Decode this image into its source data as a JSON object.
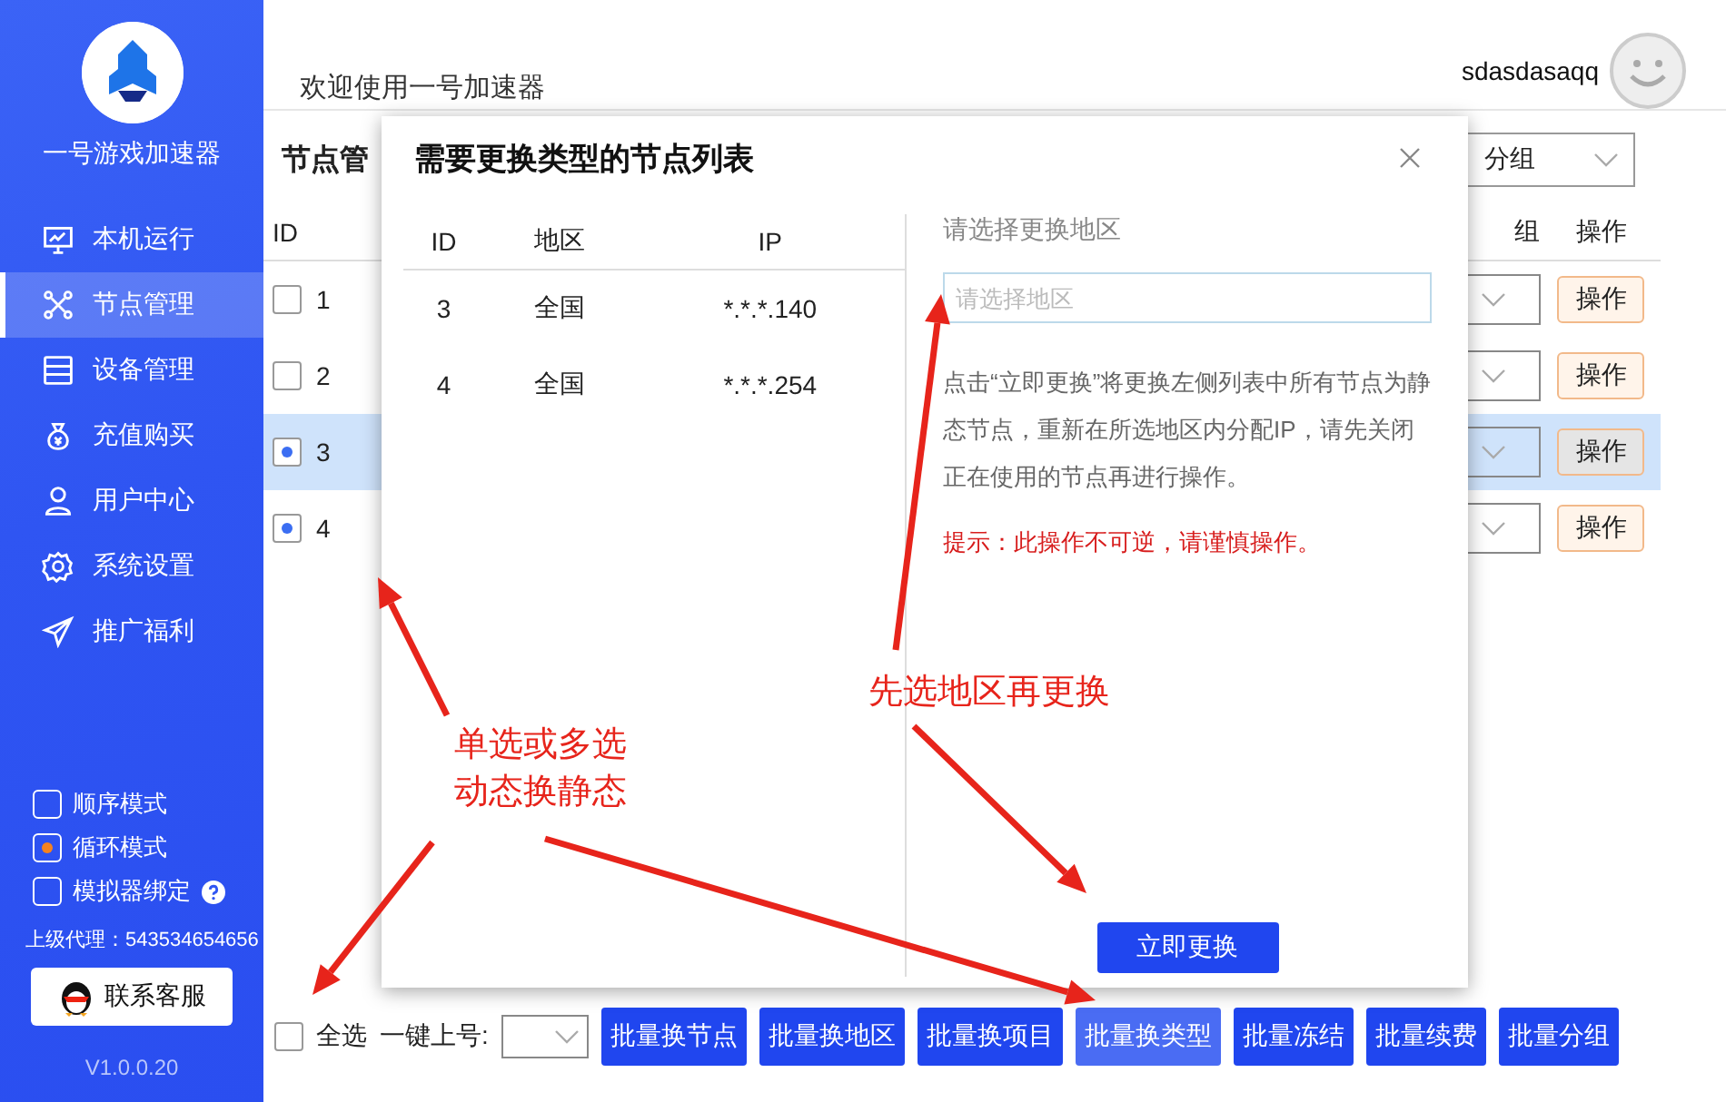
{
  "sidebar": {
    "app_name": "一号游戏加速器",
    "items": [
      {
        "label": "本机运行",
        "kind": "monitor",
        "selected": false
      },
      {
        "label": "节点管理",
        "kind": "nodes",
        "selected": true
      },
      {
        "label": "设备管理",
        "kind": "server",
        "selected": false
      },
      {
        "label": "充值购买",
        "kind": "moneybag",
        "selected": false
      },
      {
        "label": "用户中心",
        "kind": "user",
        "selected": false
      },
      {
        "label": "系统设置",
        "kind": "gear",
        "selected": false
      },
      {
        "label": "推广福利",
        "kind": "send",
        "selected": false
      }
    ],
    "modes": [
      {
        "label": "顺序模式",
        "checked": false,
        "help": false
      },
      {
        "label": "循环模式",
        "checked": true,
        "help": false
      },
      {
        "label": "模拟器绑定",
        "checked": false,
        "help": true
      }
    ],
    "agent": "上级代理：543534654656",
    "contact_button": "联系客服",
    "version": "V1.0.0.20"
  },
  "header": {
    "welcome": "欢迎使用一号加速器",
    "username": "sdasdasaqq"
  },
  "page_title": "节点管",
  "group_select": "分组",
  "table": {
    "columns": [
      "ID",
      "组",
      "操作"
    ],
    "rows": [
      {
        "id": "1",
        "checked": false,
        "selected": false,
        "action": "操作"
      },
      {
        "id": "2",
        "checked": false,
        "selected": false,
        "action": "操作"
      },
      {
        "id": "3",
        "checked": true,
        "selected": true,
        "action": "操作"
      },
      {
        "id": "4",
        "checked": true,
        "selected": false,
        "action": "操作"
      }
    ]
  },
  "bottom_bar": {
    "select_all": {
      "label": "全选",
      "checked": false
    },
    "quick_login_label": "一键上号:",
    "buttons": [
      {
        "label": "批量换节点",
        "selected": false
      },
      {
        "label": "批量换地区",
        "selected": false
      },
      {
        "label": "批量换项目",
        "selected": false
      },
      {
        "label": "批量换类型",
        "selected": true
      },
      {
        "label": "批量冻结",
        "selected": false
      },
      {
        "label": "批量续费",
        "selected": false
      },
      {
        "label": "批量分组",
        "selected": false
      }
    ]
  },
  "dialog": {
    "title": "需要更换类型的节点列表",
    "columns": [
      "ID",
      "地区",
      "IP"
    ],
    "rows": [
      [
        "3",
        "全国",
        "*.*.*.140"
      ],
      [
        "4",
        "全国",
        "*.*.*.254"
      ]
    ],
    "region_label": "请选择更换地区",
    "region_placeholder": "请选择地区",
    "description": "点击“立即更换”将更换左侧列表中所有节点为静态节点，重新在所选地区内分配IP，请先关闭正在使用的节点再进行操作。",
    "warning": "提示：此操作不可逆，请谨慎操作。",
    "confirm_button": "立即更换"
  },
  "annotations": [
    {
      "text": "单选或多选动态换静态"
    },
    {
      "text": "先选地区再更换"
    }
  ]
}
